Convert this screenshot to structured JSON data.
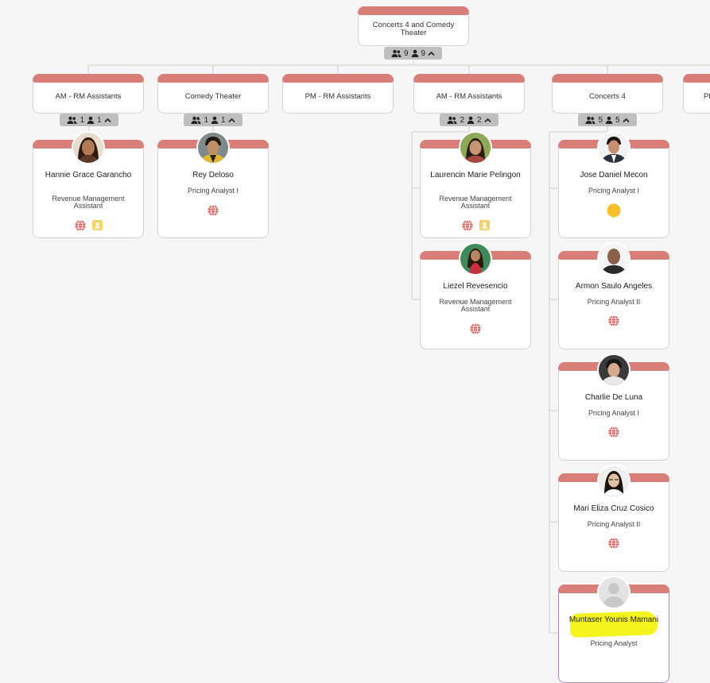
{
  "root": {
    "title": "Concerts 4 and Comedy Theater",
    "stats": {
      "total": "9",
      "direct": "9"
    }
  },
  "departments": [
    {
      "title": "AM - RM Assistants",
      "stats": {
        "total": "1",
        "direct": "1"
      }
    },
    {
      "title": "Comedy Theater",
      "stats": {
        "total": "1",
        "direct": "1"
      }
    },
    {
      "title": "PM - RM Assistants"
    },
    {
      "title": "AM - RM Assistants",
      "stats": {
        "total": "2",
        "direct": "2"
      }
    },
    {
      "title": "Concerts 4",
      "stats": {
        "total": "5",
        "direct": "5"
      }
    },
    {
      "title": "Pl"
    }
  ],
  "employees": [
    {
      "name": "Hannie Grace Garancho",
      "role": "Revenue Management Assistant",
      "icons": [
        "globe-icon",
        "contact-card-icon"
      ]
    },
    {
      "name": "Rey Deloso",
      "role": "Pricing Analyst I",
      "icons": [
        "globe-icon"
      ]
    },
    {
      "name": "Laurencin Marie Pelingon",
      "role": "Revenue Management Assistant",
      "icons": [
        "globe-icon",
        "contact-card-icon"
      ]
    },
    {
      "name": "Liezel Revesencio",
      "role": "Revenue Management Assistant",
      "icons": [
        "globe-icon"
      ]
    },
    {
      "name": "Jose Daniel Mecon",
      "role": "Pricing Analyst I",
      "icons": [
        "status-dot-icon"
      ]
    },
    {
      "name": "Armon Saulo Angeles",
      "role": "Pricing Analyst II",
      "icons": [
        "globe-icon"
      ]
    },
    {
      "name": "Charlie De Luna",
      "role": "Pricing Analyst I",
      "icons": [
        "globe-icon"
      ]
    },
    {
      "name": "Mari Eliza Cruz Cosico",
      "role": "Pricing Analyst II",
      "icons": [
        "globe-icon"
      ]
    },
    {
      "name": "Muntaser Younis Mamani",
      "role": "Pricing Analyst",
      "icons": [],
      "selected": true
    }
  ],
  "colors": {
    "card_header": "#d97f79",
    "connector": "#cfcfcf",
    "pill": "#bfbfbf",
    "globe": "#d9534f",
    "contact_card": "#f5d36b",
    "status_dot": "#f7c02b",
    "highlight": "#f5f31c",
    "selected_border": "#a98ad0"
  }
}
